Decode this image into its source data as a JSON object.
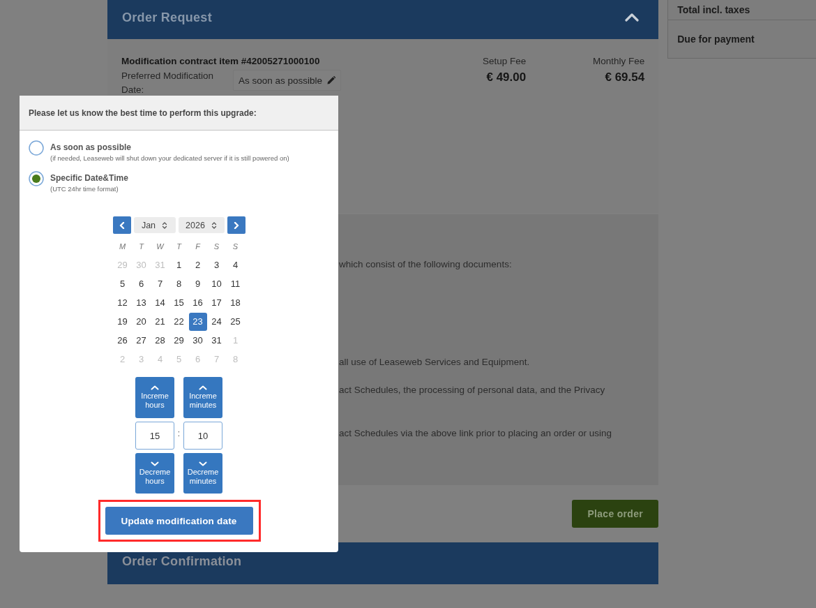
{
  "order_request": {
    "title": "Order Request",
    "expanded": true,
    "item": {
      "title": "Modification contract item #42005271000100",
      "date_label": "Preferred Modification Date:",
      "date_value": "As soon as possible"
    },
    "fees": [
      {
        "label": "Setup Fee",
        "amount": "€ 49.00"
      },
      {
        "label": "Monthly Fee",
        "amount": "€ 69.54"
      }
    ],
    "terms_lines": [
      "which consist of the following documents:",
      "all use of Leaseweb Services and Equipment.",
      "act Schedules, the processing of personal data, and the Privacy",
      "act Schedules via the above link prior to placing an order or using"
    ],
    "place_order_button": "Place order"
  },
  "order_confirmation": {
    "title": "Order Confirmation"
  },
  "summary": {
    "rows": [
      "Total incl. taxes",
      "Due for payment"
    ]
  },
  "date_popup": {
    "prompt": "Please let us know the best time to perform this upgrade:",
    "options": [
      {
        "label": "As soon as possible",
        "hint": "(if needed, Leaseweb will shut down your dedicated server if it is still powered on)",
        "selected": false
      },
      {
        "label": "Specific Date&Time",
        "hint": "(UTC 24hr time format)",
        "selected": true
      }
    ],
    "calendar": {
      "month": "Jan",
      "year": "2026",
      "weekdays": [
        "M",
        "T",
        "W",
        "T",
        "F",
        "S",
        "S"
      ],
      "weeks": [
        [
          {
            "day": "29",
            "outside": true,
            "selected": false
          },
          {
            "day": "30",
            "outside": true,
            "selected": false
          },
          {
            "day": "31",
            "outside": true,
            "selected": false
          },
          {
            "day": "1",
            "outside": false,
            "selected": false
          },
          {
            "day": "2",
            "outside": false,
            "selected": false
          },
          {
            "day": "3",
            "outside": false,
            "selected": false
          },
          {
            "day": "4",
            "outside": false,
            "selected": false
          }
        ],
        [
          {
            "day": "5",
            "outside": false,
            "selected": false
          },
          {
            "day": "6",
            "outside": false,
            "selected": false
          },
          {
            "day": "7",
            "outside": false,
            "selected": false
          },
          {
            "day": "8",
            "outside": false,
            "selected": false
          },
          {
            "day": "9",
            "outside": false,
            "selected": false
          },
          {
            "day": "10",
            "outside": false,
            "selected": false
          },
          {
            "day": "11",
            "outside": false,
            "selected": false
          }
        ],
        [
          {
            "day": "12",
            "outside": false,
            "selected": false
          },
          {
            "day": "13",
            "outside": false,
            "selected": false
          },
          {
            "day": "14",
            "outside": false,
            "selected": false
          },
          {
            "day": "15",
            "outside": false,
            "selected": false
          },
          {
            "day": "16",
            "outside": false,
            "selected": false
          },
          {
            "day": "17",
            "outside": false,
            "selected": false
          },
          {
            "day": "18",
            "outside": false,
            "selected": false
          }
        ],
        [
          {
            "day": "19",
            "outside": false,
            "selected": false
          },
          {
            "day": "20",
            "outside": false,
            "selected": false
          },
          {
            "day": "21",
            "outside": false,
            "selected": false
          },
          {
            "day": "22",
            "outside": false,
            "selected": false
          },
          {
            "day": "23",
            "outside": false,
            "selected": true
          },
          {
            "day": "24",
            "outside": false,
            "selected": false
          },
          {
            "day": "25",
            "outside": false,
            "selected": false
          }
        ],
        [
          {
            "day": "26",
            "outside": false,
            "selected": false
          },
          {
            "day": "27",
            "outside": false,
            "selected": false
          },
          {
            "day": "28",
            "outside": false,
            "selected": false
          },
          {
            "day": "29",
            "outside": false,
            "selected": false
          },
          {
            "day": "30",
            "outside": false,
            "selected": false
          },
          {
            "day": "31",
            "outside": false,
            "selected": false
          },
          {
            "day": "1",
            "outside": true,
            "selected": false
          }
        ],
        [
          {
            "day": "2",
            "outside": true,
            "selected": false
          },
          {
            "day": "3",
            "outside": true,
            "selected": false
          },
          {
            "day": "4",
            "outside": true,
            "selected": false
          },
          {
            "day": "5",
            "outside": true,
            "selected": false
          },
          {
            "day": "6",
            "outside": true,
            "selected": false
          },
          {
            "day": "7",
            "outside": true,
            "selected": false
          },
          {
            "day": "8",
            "outside": true,
            "selected": false
          }
        ]
      ]
    },
    "time": {
      "hours": {
        "increment_label": "Increme hours",
        "value": "15",
        "decrement_label": "Decreme hours"
      },
      "separator": ":",
      "minutes": {
        "increment_label": "Increme minutes",
        "value": "10",
        "decrement_label": "Decreme minutes"
      }
    },
    "update_button": {
      "label": "Update modification date",
      "highlighted": true
    }
  }
}
